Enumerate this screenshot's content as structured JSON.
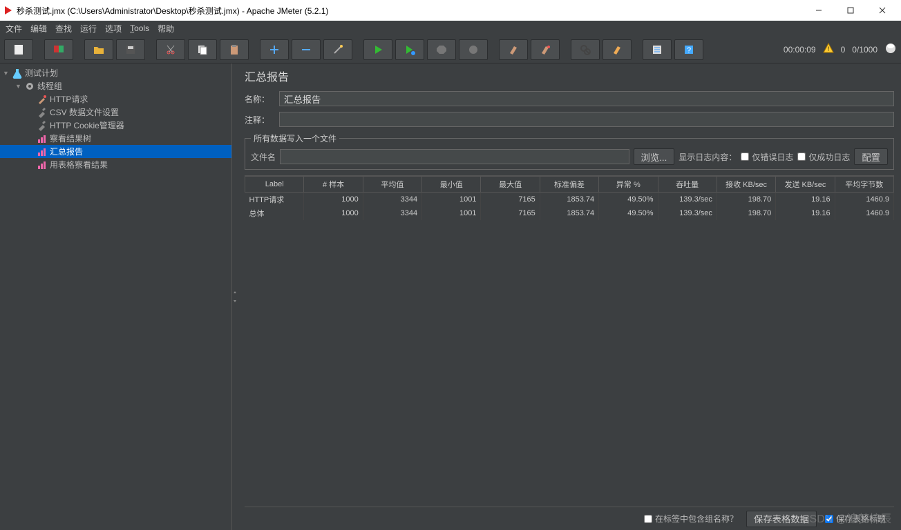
{
  "title": "秒杀测试.jmx (C:\\Users\\Administrator\\Desktop\\秒杀测试.jmx) - Apache JMeter (5.2.1)",
  "menu": {
    "file": "文件",
    "edit": "编辑",
    "search": "查找",
    "run": "运行",
    "options": "选项",
    "tools": "Tools",
    "help": "帮助"
  },
  "status": {
    "timer": "00:00:09",
    "errors": "0",
    "threads": "0/1000"
  },
  "tree": [
    {
      "label": "测试计划",
      "indent": 0,
      "icon": "flask",
      "toggle": "▼"
    },
    {
      "label": "线程组",
      "indent": 1,
      "icon": "gear",
      "toggle": "▼"
    },
    {
      "label": "HTTP请求",
      "indent": 2,
      "icon": "pipette"
    },
    {
      "label": "CSV 数据文件设置",
      "indent": 2,
      "icon": "wrench"
    },
    {
      "label": "HTTP Cookie管理器",
      "indent": 2,
      "icon": "wrench"
    },
    {
      "label": "察看结果树",
      "indent": 2,
      "icon": "chart"
    },
    {
      "label": "汇总报告",
      "indent": 2,
      "icon": "chart",
      "selected": true
    },
    {
      "label": "用表格察看结果",
      "indent": 2,
      "icon": "chart"
    }
  ],
  "panel": {
    "heading": "汇总报告",
    "name_label": "名称：",
    "name_value": "汇总报告",
    "comment_label": "注释：",
    "comment_value": "",
    "file_fieldset": "所有数据写入一个文件",
    "filename_label": "文件名",
    "filename_value": "",
    "browse": "浏览...",
    "show_log": "显示日志内容：",
    "errors_only": "仅错误日志",
    "success_only": "仅成功日志",
    "configure": "配置"
  },
  "table": {
    "headers": [
      "Label",
      "# 样本",
      "平均值",
      "最小值",
      "最大值",
      "标准偏差",
      "异常 %",
      "吞吐量",
      "接收 KB/sec",
      "发送 KB/sec",
      "平均字节数"
    ],
    "rows": [
      [
        "HTTP请求",
        "1000",
        "3344",
        "1001",
        "7165",
        "1853.74",
        "49.50%",
        "139.3/sec",
        "198.70",
        "19.16",
        "1460.9"
      ],
      [
        "总体",
        "1000",
        "3344",
        "1001",
        "7165",
        "1853.74",
        "49.50%",
        "139.3/sec",
        "198.70",
        "19.16",
        "1460.9"
      ]
    ]
  },
  "bottom": {
    "include_group": "在标签中包含组名称？",
    "save_data": "保存表格数据",
    "save_header": "保存表格标题"
  },
  "watermark": "CSDN @追梦梓辰"
}
